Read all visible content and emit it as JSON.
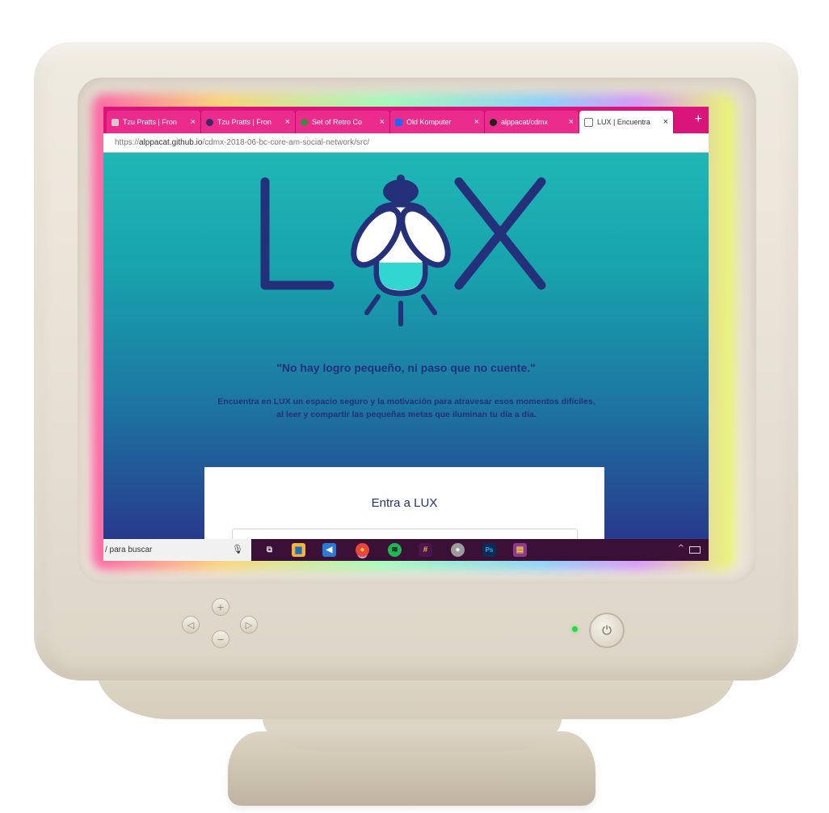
{
  "browser": {
    "tabs": [
      {
        "label": "Tzu Pratts | Fron",
        "favicon": "page-icon",
        "color": "#d7c9d2"
      },
      {
        "label": "Tzu Pratts | Fron",
        "favicon": "react-icon",
        "color": "#3a2a6a"
      },
      {
        "label": "Set of Retro Co",
        "favicon": "globe-icon",
        "color": "#3b8b3b"
      },
      {
        "label": "Old Komputer",
        "favicon": "behance-icon",
        "color": "#1769ff"
      },
      {
        "label": "alppacat/cdmx",
        "favicon": "github-icon",
        "color": "#222222"
      },
      {
        "label": "LUX | Encuentra",
        "favicon": "page-icon",
        "color": "#ffffff"
      }
    ],
    "close_glyph": "×",
    "new_tab_glyph": "+",
    "url_scheme": "https://",
    "url_host": "alppacat.github.io",
    "url_path": "/cdmx-2018-06-bc-core-am-social-network/src/"
  },
  "page": {
    "logo_text": "LUX",
    "quote": "\"No hay logro pequeño, ni paso que no cuente.\"",
    "intro": "Encuentra en LUX un espacio seguro y la motivación para atravesar esos momentos difíciles, al leer y compartir las pequeñas metas que iluminan tu día a día.",
    "login_title": "Entra a LUX"
  },
  "taskbar": {
    "search_text": "/ para buscar",
    "apps": [
      {
        "name": "task-view",
        "glyph": "⧉",
        "color": "#3b1036"
      },
      {
        "name": "file-explorer",
        "glyph": "▆",
        "color": "#f2b632"
      },
      {
        "name": "vscode",
        "glyph": "◀",
        "color": "#2a7bd6"
      },
      {
        "name": "chrome",
        "glyph": "●",
        "color": "#e8453c"
      },
      {
        "name": "spotify",
        "glyph": "≋",
        "color": "#1db954"
      },
      {
        "name": "slack",
        "glyph": "#",
        "color": "#4a154b"
      },
      {
        "name": "generic-app",
        "glyph": "●",
        "color": "#9c9c9c"
      },
      {
        "name": "photoshop",
        "glyph": "Ps",
        "color": "#0c2b55"
      },
      {
        "name": "winrar",
        "glyph": "▤",
        "color": "#8a3b8e"
      }
    ]
  },
  "controls": {
    "up_glyph": "+",
    "down_glyph": "−",
    "left_glyph": "◁",
    "right_glyph": "▷",
    "power_glyph": "⏻"
  },
  "colors": {
    "tab_bar": "#d9157c",
    "page_top": "#1fb7b5",
    "page_bottom": "#283a8c",
    "brand_navy": "#25307a",
    "taskbar": "#3b1036"
  }
}
